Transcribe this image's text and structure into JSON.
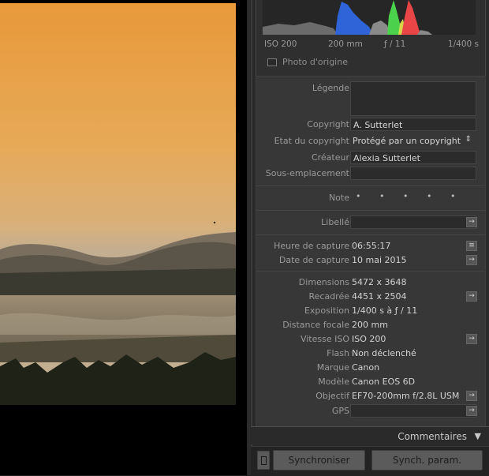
{
  "histogram": {
    "iso": "ISO 200",
    "focal": "200 mm",
    "aperture": "ƒ / 11",
    "shutter": "1/400 s",
    "original_photo_label": "Photo d'origine"
  },
  "metadata": {
    "legende_label": "Légende",
    "copyright_label": "Copyright",
    "copyright_value": "A. Sutterlet",
    "etat_label": "Etat du copyright",
    "etat_value": "Protégé par un copyright",
    "createur_label": "Créateur",
    "createur_value": "Alexia Sutterlet",
    "sous_label": "Sous-emplacement",
    "note_label": "Note",
    "note_value": "• • • • •",
    "libelle_label": "Libellé",
    "heure_label": "Heure de capture",
    "heure_value": "06:55:17",
    "date_label": "Date de capture",
    "date_value": "10 mai 2015",
    "dimensions_label": "Dimensions",
    "dimensions_value": "5472 x 3648",
    "recadree_label": "Recadrée",
    "recadree_value": "4451 x 2504",
    "exposition_label": "Exposition",
    "exposition_value": "1/400 s à ƒ / 11",
    "distance_label": "Distance focale",
    "distance_value": "200 mm",
    "iso_label": "Vitesse ISO",
    "iso_value": "ISO 200",
    "flash_label": "Flash",
    "flash_value": "Non déclenché",
    "marque_label": "Marque",
    "marque_value": "Canon",
    "modele_label": "Modèle",
    "modele_value": "Canon EOS 6D",
    "objectif_label": "Objectif",
    "objectif_value": "EF70-200mm f/2.8L USM",
    "gps_label": "GPS"
  },
  "comments_section": "Commentaires",
  "bottom": {
    "sync_button": "Synchroniser",
    "sync_param_button": "Synch. param."
  },
  "colors": {
    "sky_top": "#e89a3c",
    "sky_bottom": "#c9a877",
    "panel": "#373737"
  }
}
